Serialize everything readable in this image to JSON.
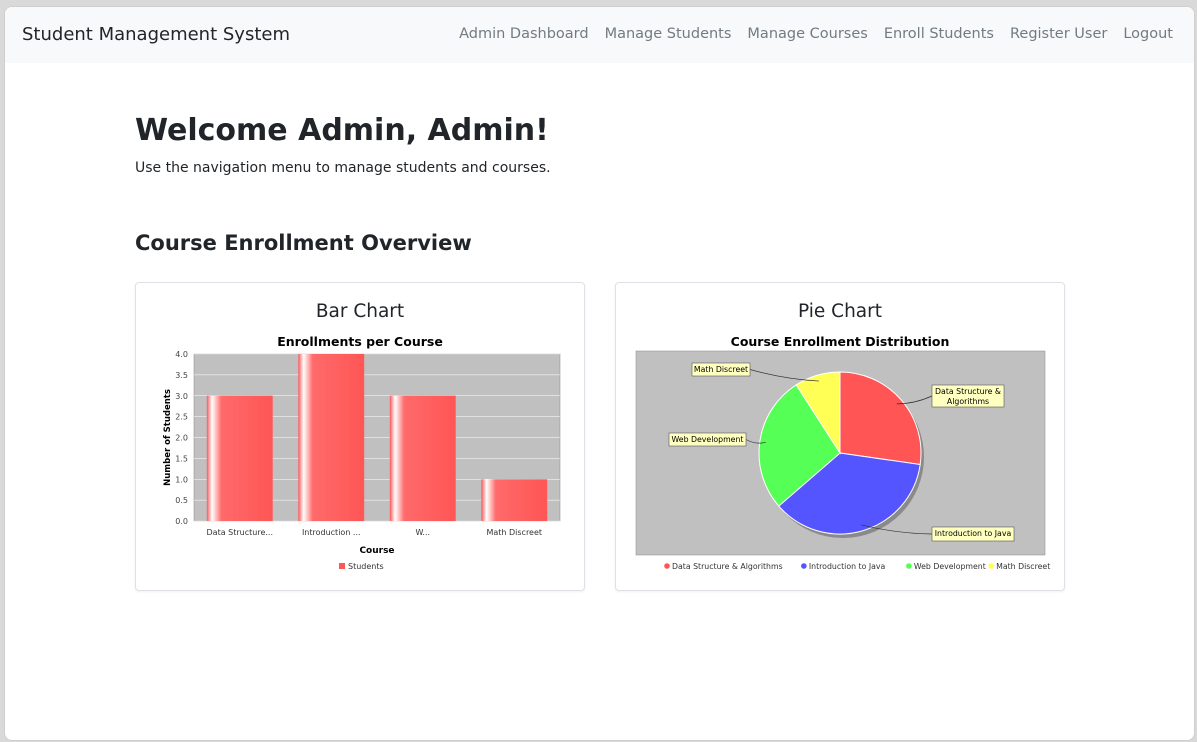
{
  "navbar": {
    "brand": "Student Management System",
    "links": [
      "Admin Dashboard",
      "Manage Students",
      "Manage Courses",
      "Enroll Students",
      "Register User",
      "Logout"
    ]
  },
  "main": {
    "welcome": "Welcome Admin, Admin!",
    "subtitle": "Use the navigation menu to manage students and courses.",
    "section_title": "Course Enrollment Overview"
  },
  "cards": {
    "bar_title": "Bar Chart",
    "pie_title": "Pie Chart"
  },
  "chart_data": [
    {
      "type": "bar",
      "title": "Enrollments per Course",
      "xlabel": "Course",
      "ylabel": "Number of Students",
      "categories": [
        "Data Structure...",
        "Introduction ...",
        "W...",
        "Math Discreet"
      ],
      "series": [
        {
          "name": "Students",
          "values": [
            3,
            4,
            3,
            1
          ]
        }
      ],
      "ylim": [
        0,
        4.0
      ],
      "yticks": [
        "0.0",
        "0.5",
        "1.0",
        "1.5",
        "2.0",
        "2.5",
        "3.0",
        "3.5",
        "4.0"
      ],
      "grid": true,
      "legend": "bottom",
      "color": "#ff5555",
      "plot_bg": "#c0c0c0"
    },
    {
      "type": "pie",
      "title": "Course Enrollment Distribution",
      "labels": [
        "Data Structure & Algorithms",
        "Introduction to Java",
        "Web Development",
        "Math Discreet"
      ],
      "callout_labels": [
        "Data Structure &\nAlgorithms",
        "Introduction to Java",
        "Web Development",
        "Math Discreet"
      ],
      "values": [
        3,
        4,
        3,
        1
      ],
      "colors": [
        "#ff5555",
        "#5555ff",
        "#55ff55",
        "#ffff55"
      ],
      "legend": "bottom",
      "plot_bg": "#c0c0c0"
    }
  ]
}
